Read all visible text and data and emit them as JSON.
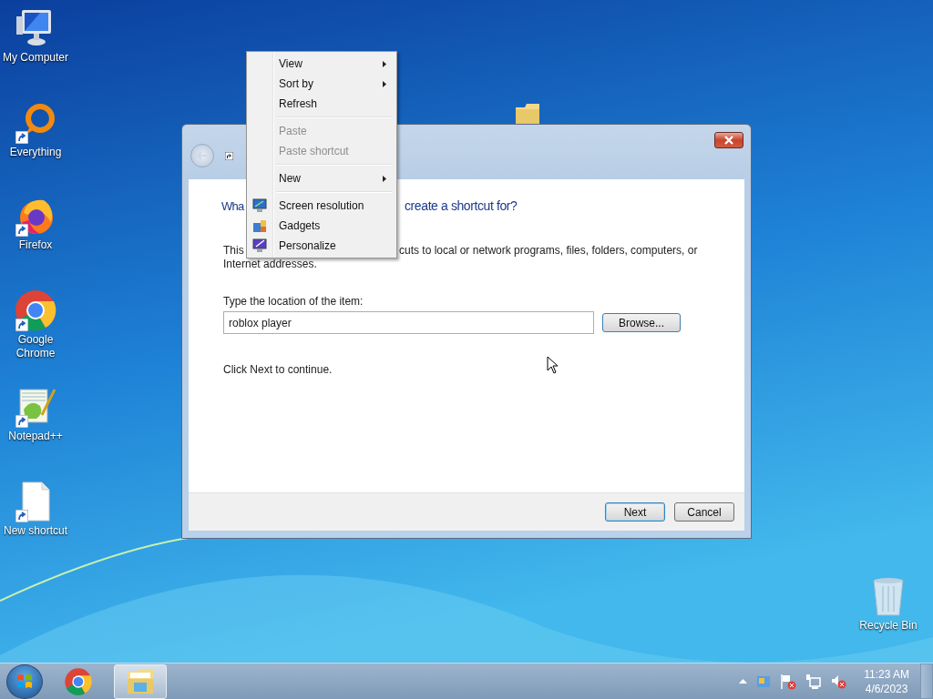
{
  "desktop_icons": [
    {
      "label": "My Computer",
      "kind": "computer",
      "shortcut": false
    },
    {
      "label": "Everything",
      "kind": "everything",
      "shortcut": true
    },
    {
      "label": "Firefox",
      "kind": "firefox",
      "shortcut": true
    },
    {
      "label": "Google Chrome",
      "kind": "chrome",
      "shortcut": true
    },
    {
      "label": "Notepad++",
      "kind": "notepad",
      "shortcut": true
    },
    {
      "label": "New shortcut",
      "kind": "blank",
      "shortcut": true
    }
  ],
  "recycle_bin": {
    "label": "Recycle Bin"
  },
  "dialog": {
    "heading_visible": [
      "Wha",
      "create a shortcut for?"
    ],
    "description_visible": [
      "This",
      "cuts to local or network programs, files, folders, computers, or",
      "Internet addresses."
    ],
    "location_label": "Type the location of the item:",
    "location_value": "roblox player",
    "browse": "Browse...",
    "hint": "Click Next to continue.",
    "buttons": [
      {
        "label": "Next",
        "default": true
      },
      {
        "label": "Cancel",
        "default": false
      }
    ]
  },
  "context_menu": {
    "items": [
      {
        "kind": "item",
        "label": "View",
        "submenu": true,
        "disabled": false
      },
      {
        "kind": "item",
        "label": "Sort by",
        "submenu": true,
        "disabled": false
      },
      {
        "kind": "item",
        "label": "Refresh",
        "submenu": false,
        "disabled": false
      },
      {
        "kind": "separator"
      },
      {
        "kind": "item",
        "label": "Paste",
        "submenu": false,
        "disabled": true
      },
      {
        "kind": "item",
        "label": "Paste shortcut",
        "submenu": false,
        "disabled": true
      },
      {
        "kind": "separator"
      },
      {
        "kind": "item",
        "label": "New",
        "submenu": true,
        "disabled": false
      },
      {
        "kind": "separator"
      },
      {
        "kind": "item",
        "label": "Screen resolution",
        "submenu": false,
        "disabled": false
      },
      {
        "kind": "item",
        "label": "Gadgets",
        "submenu": false,
        "disabled": false
      },
      {
        "kind": "item",
        "label": "Personalize",
        "submenu": false,
        "disabled": false
      }
    ]
  },
  "taskbar": {
    "apps": [
      {
        "kind": "chrome",
        "active": false
      },
      {
        "kind": "explorer",
        "active": true
      }
    ],
    "clock": {
      "time": "11:23 AM",
      "date": "4/6/2023"
    }
  }
}
